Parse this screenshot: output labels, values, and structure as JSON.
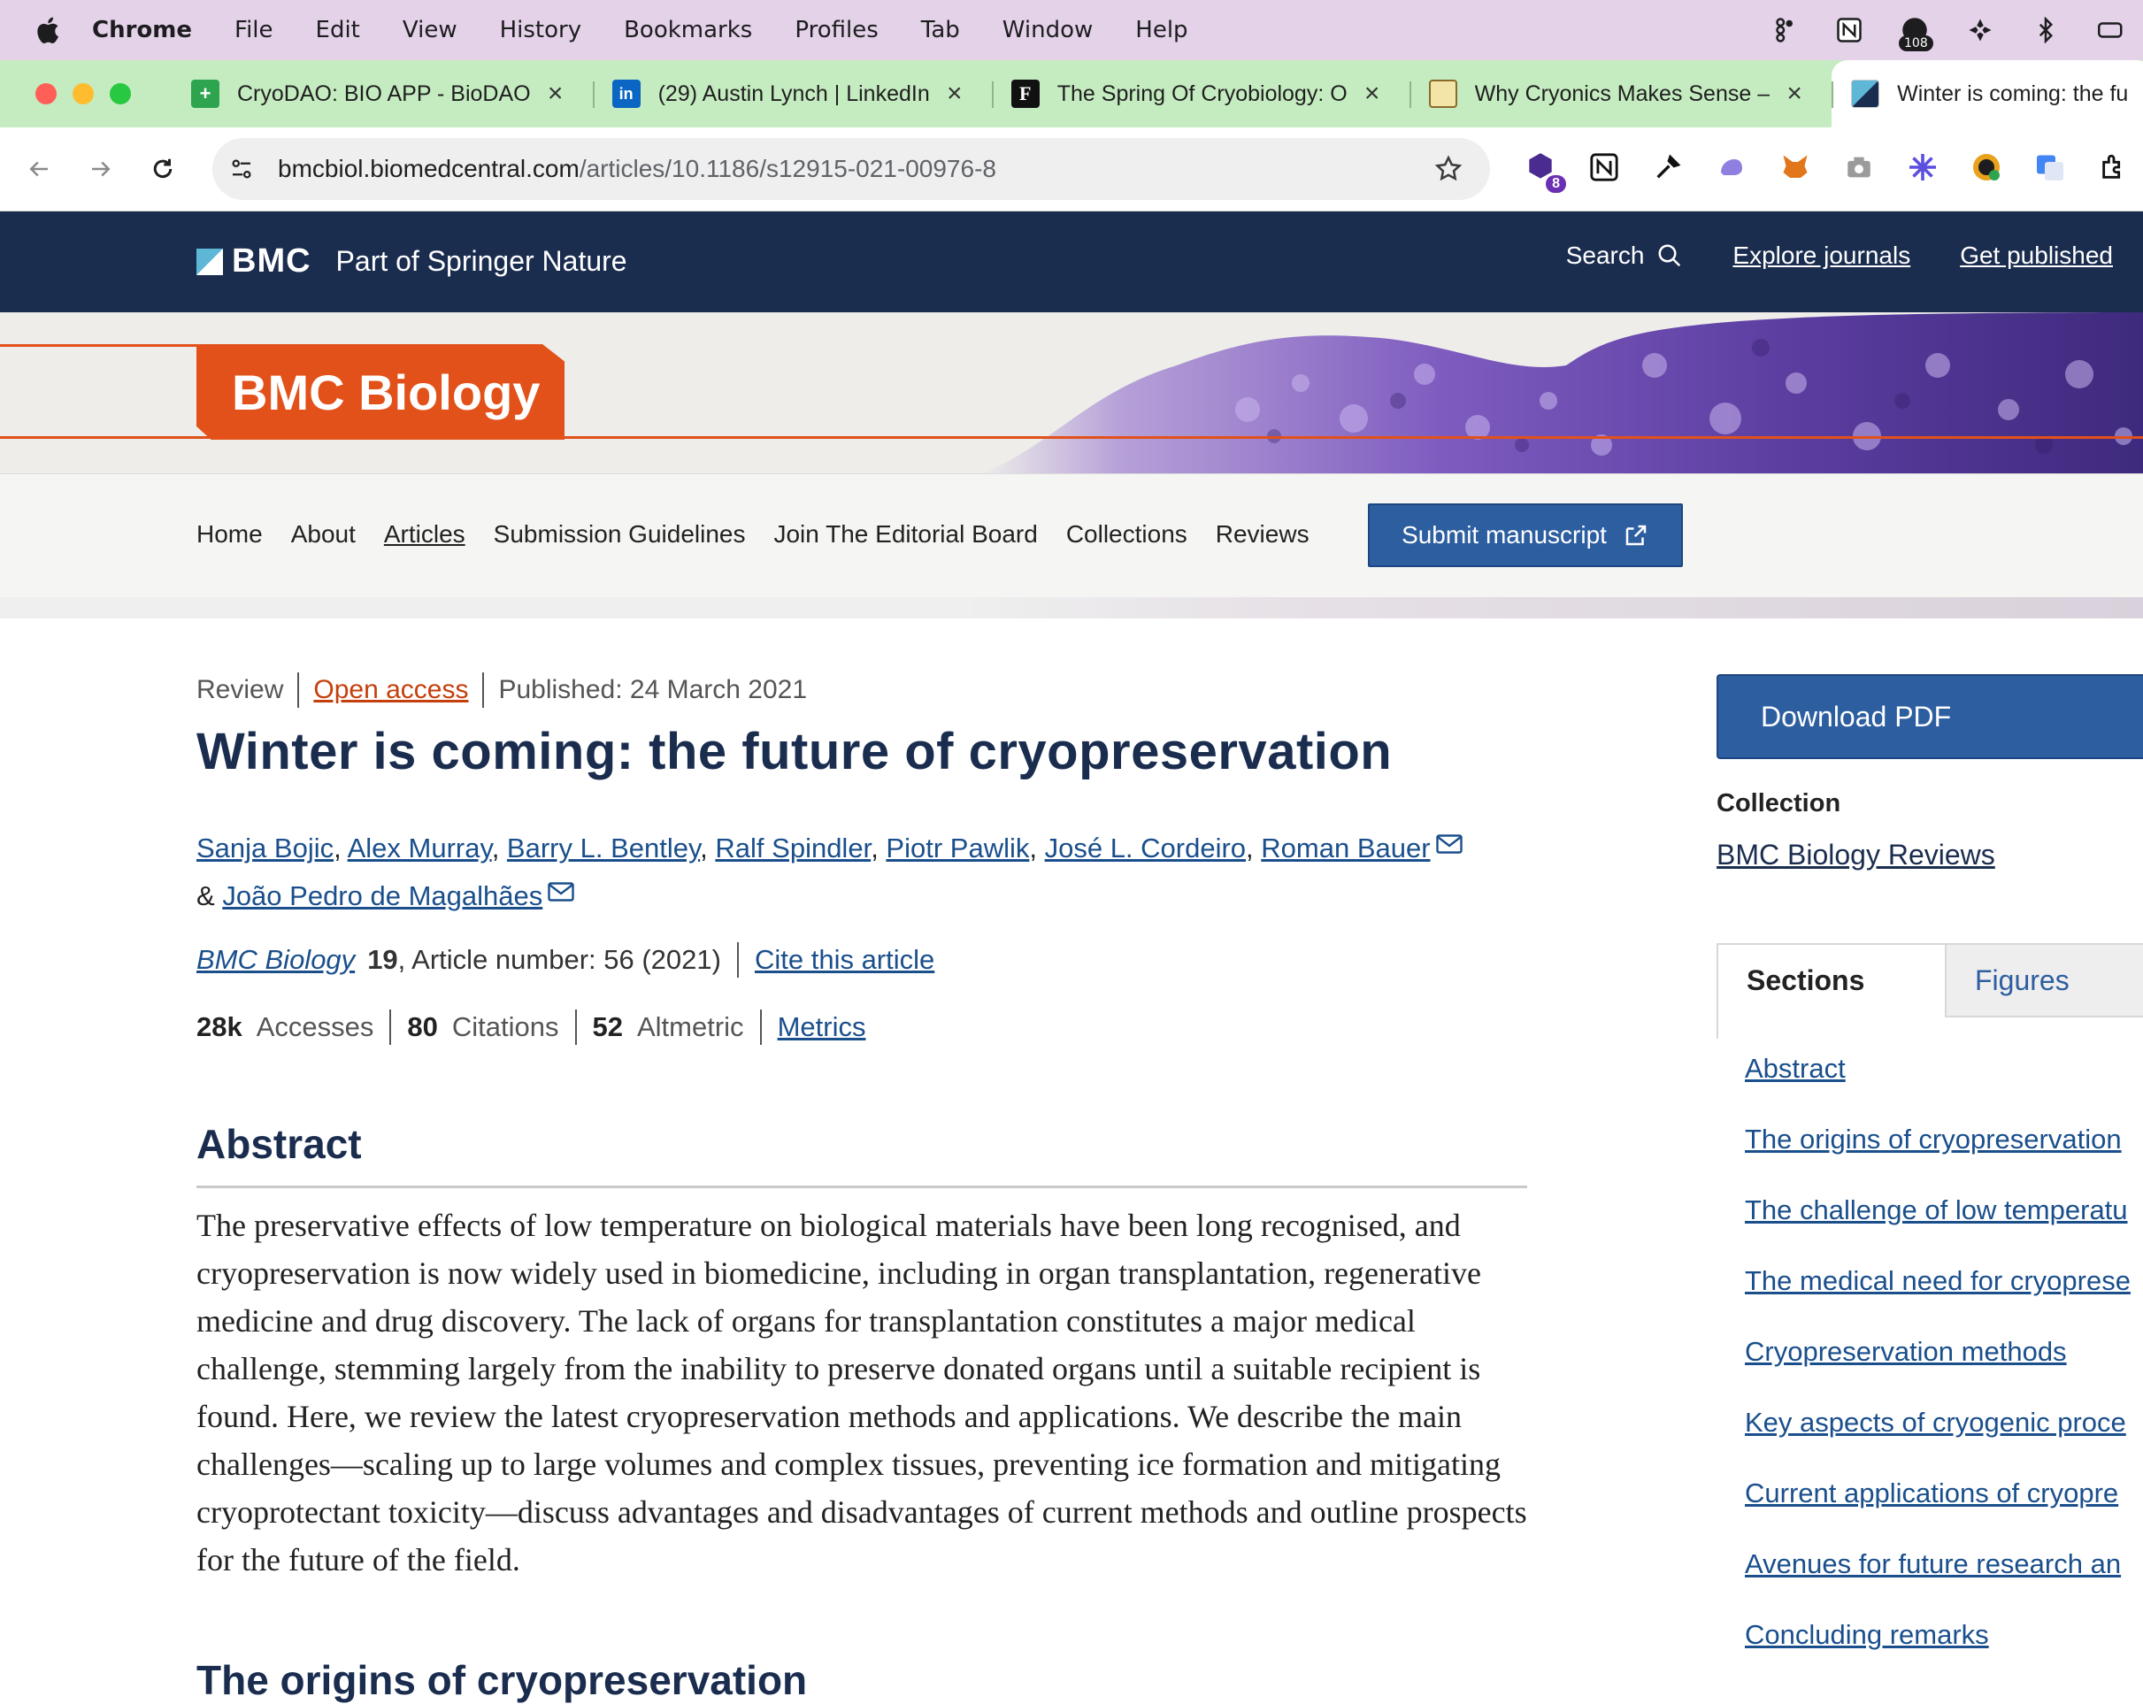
{
  "menubar": {
    "app_name": "Chrome",
    "menus": [
      "File",
      "Edit",
      "View",
      "History",
      "Bookmarks",
      "Profiles",
      "Tab",
      "Window",
      "Help"
    ],
    "notification_count": "108"
  },
  "tabs": [
    {
      "title": "CryoDAO: BIO APP - BioDAO",
      "favicon": "green-plus-icon"
    },
    {
      "title": "(29) Austin Lynch | LinkedIn",
      "favicon": "linkedin-icon"
    },
    {
      "title": "The Spring Of Cryobiology: O",
      "favicon": "f-letter-icon"
    },
    {
      "title": "Why Cryonics Makes Sense –",
      "favicon": "comic-icon"
    },
    {
      "title": "Winter is coming: the fu",
      "favicon": "bmc-icon",
      "active": true
    }
  ],
  "toolbar": {
    "url_host": "bmcbiol.biomedcentral.com",
    "url_path": "/articles/10.1186/s12915-021-00976-8",
    "extension_badge": "8"
  },
  "site_header": {
    "logo_text": "BMC",
    "tagline": "Part of Springer Nature",
    "search_label": "Search",
    "links": [
      "Explore journals",
      "Get published"
    ]
  },
  "journal": {
    "name": "BMC Biology",
    "nav": [
      "Home",
      "About",
      "Articles",
      "Submission Guidelines",
      "Join The Editorial Board",
      "Collections",
      "Reviews"
    ],
    "current_nav": "Articles",
    "submit_label": "Submit manuscript"
  },
  "article": {
    "type": "Review",
    "access": "Open access",
    "published": "Published: 24 March 2021",
    "title": "Winter is coming: the future of cryopreservation",
    "authors_line1": [
      "Sanja Bojic",
      "Alex Murray",
      "Barry L. Bentley",
      "Ralf Spindler",
      "Piotr Pawlik",
      "José L. Cordeiro",
      "Roman Bauer"
    ],
    "authors_amp": "&",
    "author_last": "João Pedro de Magalhães",
    "journal_name": "BMC Biology",
    "volume": "19",
    "article_number": ", Article number: 56 (2021)",
    "cite_label": "Cite this article",
    "accesses_value": "28k",
    "accesses_label": "Accesses",
    "citations_value": "80",
    "citations_label": "Citations",
    "altmetric_value": "52",
    "altmetric_label": "Altmetric",
    "metrics_label": "Metrics",
    "abstract_heading": "Abstract",
    "abstract_text": "The preservative effects of low temperature on biological materials have been long recognised, and cryopreservation is now widely used in biomedicine, including in organ transplantation, regenerative medicine and drug discovery. The lack of organs for transplantation constitutes a major medical challenge, stemming largely from the inability to preserve donated organs until a suitable recipient is found. Here, we review the latest cryopreservation methods and applications. We describe the main challenges—scaling up to large volumes and complex tissues, preventing ice formation and mitigating cryoprotectant toxicity—discuss advantages and disadvantages of current methods and outline prospects for the future of the field.",
    "next_heading": "The origins of cryopreservation"
  },
  "sidebar": {
    "download_label": "Download PDF",
    "collection_label": "Collection",
    "collection_link": "BMC Biology Reviews",
    "tab_sections": "Sections",
    "tab_figures": "Figures",
    "toc": [
      "Abstract",
      "The origins of cryopreservation",
      "The challenge of low temperatu",
      "The medical need for cryopresе",
      "Cryopreservation methods",
      "Key aspects of cryogenic proce",
      "Current applications of cryopre",
      "Avenues for future research an",
      "Concluding remarks"
    ]
  },
  "colors": {
    "header_navy": "#1b2d4f",
    "journal_orange": "#e2511a",
    "link_blue": "#1a4f8c",
    "button_blue": "#2d5ea0",
    "tabstrip_green": "#c5ecc0",
    "menubar_lilac": "#e3d2e8"
  }
}
